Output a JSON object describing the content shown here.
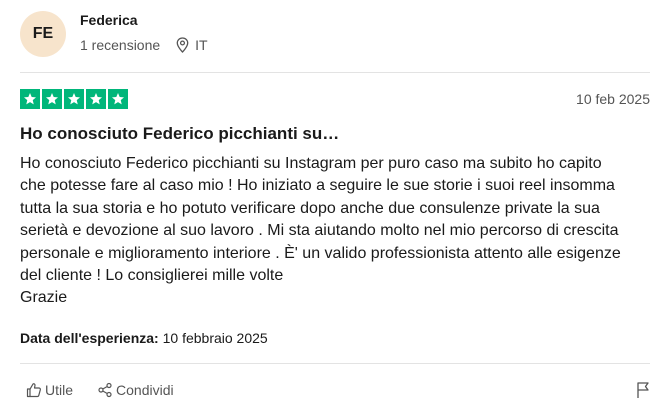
{
  "reviewer": {
    "initials": "FE",
    "name": "Federica",
    "review_count": "1 recensione",
    "country": "IT",
    "avatar_color": "#f7e4cc"
  },
  "review": {
    "rating": 5,
    "max_rating": 5,
    "star_color": "#00b67a",
    "date": "10 feb 2025",
    "title": "Ho conosciuto Federico picchianti su…",
    "body": "Ho conosciuto Federico picchianti su Instagram per puro caso ma subito ho capito\nche potesse fare al caso mio ! Ho iniziato a seguire le sue storie i suoi reel insomma\ntutta la sua storia e ho potuto verificare dopo anche due consulenze private la sua\nserietà e devozione al suo lavoro . Mi sta aiutando molto nel mio percorso di crescita\npersonale e miglioramento interiore . È' un valido professionista attento alle esigenze\ndel cliente ! Lo consiglierei mille volte\nGrazie",
    "experience_label": "Data dell'esperienza:",
    "experience_date": "10 febbraio 2025"
  },
  "actions": {
    "useful_label": "Utile",
    "share_label": "Condividi",
    "icons": [
      "thumbs-up-icon",
      "share-icon",
      "flag-icon",
      "location-pin-icon",
      "star-icon"
    ]
  }
}
